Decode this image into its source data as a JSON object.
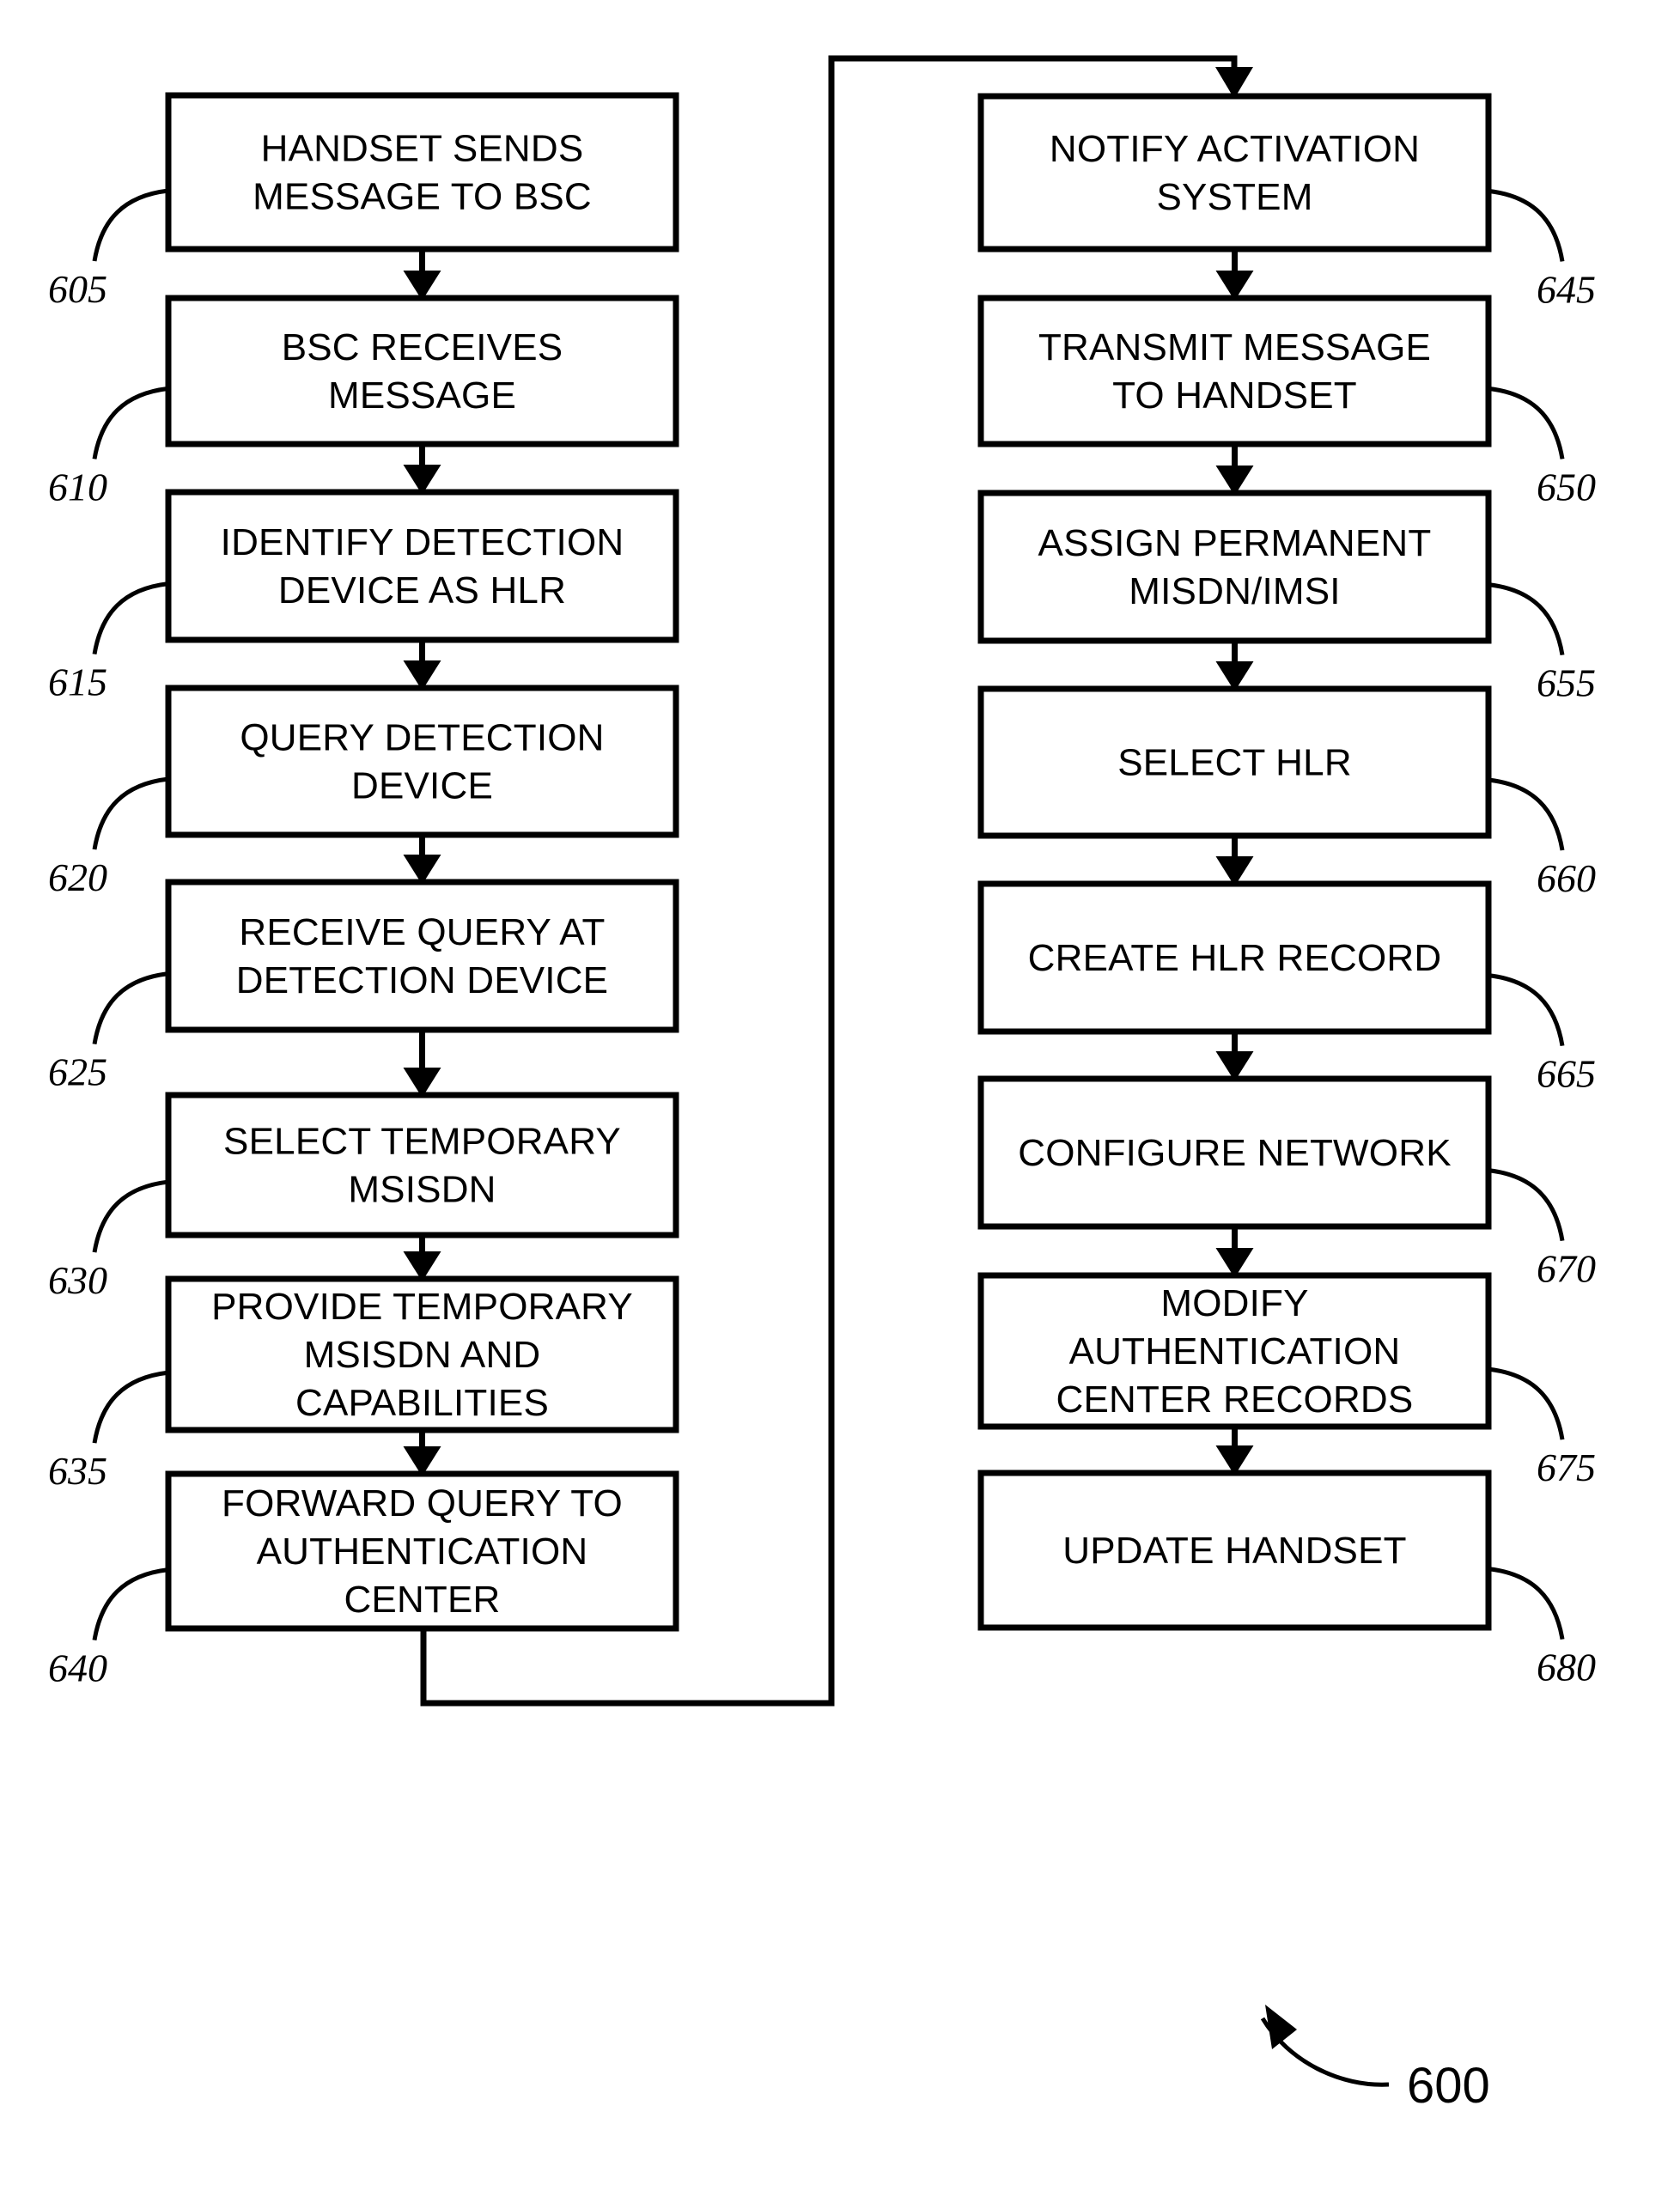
{
  "figure": {
    "number": "600",
    "type": "patent-flowchart",
    "background_color": "#ffffff",
    "line_color": "#000000"
  },
  "left_column": {
    "steps": [
      {
        "ref": "605",
        "lines": [
          "HANDSET SENDS",
          "MESSAGE TO BSC"
        ]
      },
      {
        "ref": "610",
        "lines": [
          "BSC RECEIVES",
          "MESSAGE"
        ]
      },
      {
        "ref": "615",
        "lines": [
          "IDENTIFY DETECTION",
          "DEVICE AS HLR"
        ]
      },
      {
        "ref": "620",
        "lines": [
          "QUERY DETECTION",
          "DEVICE"
        ]
      },
      {
        "ref": "625",
        "lines": [
          "RECEIVE QUERY AT",
          "DETECTION DEVICE"
        ]
      },
      {
        "ref": "630",
        "lines": [
          "SELECT TEMPORARY",
          "MSISDN"
        ]
      },
      {
        "ref": "635",
        "lines": [
          "PROVIDE TEMPORARY",
          "MSISDN AND",
          "CAPABILITIES"
        ]
      },
      {
        "ref": "640",
        "lines": [
          "FORWARD QUERY TO",
          "AUTHENTICATION",
          "CENTER"
        ]
      }
    ]
  },
  "right_column": {
    "steps": [
      {
        "ref": "645",
        "lines": [
          "NOTIFY ACTIVATION",
          "SYSTEM"
        ]
      },
      {
        "ref": "650",
        "lines": [
          "TRANSMIT MESSAGE",
          "TO HANDSET"
        ]
      },
      {
        "ref": "655",
        "lines": [
          "ASSIGN PERMANENT",
          "MISDN/IMSI"
        ]
      },
      {
        "ref": "660",
        "lines": [
          "SELECT HLR"
        ]
      },
      {
        "ref": "665",
        "lines": [
          "CREATE HLR RECORD"
        ]
      },
      {
        "ref": "670",
        "lines": [
          "CONFIGURE NETWORK"
        ]
      },
      {
        "ref": "675",
        "lines": [
          "MODIFY",
          "AUTHENTICATION",
          "CENTER RECORDS"
        ]
      },
      {
        "ref": "680",
        "lines": [
          "UPDATE HANDSET"
        ]
      }
    ]
  }
}
